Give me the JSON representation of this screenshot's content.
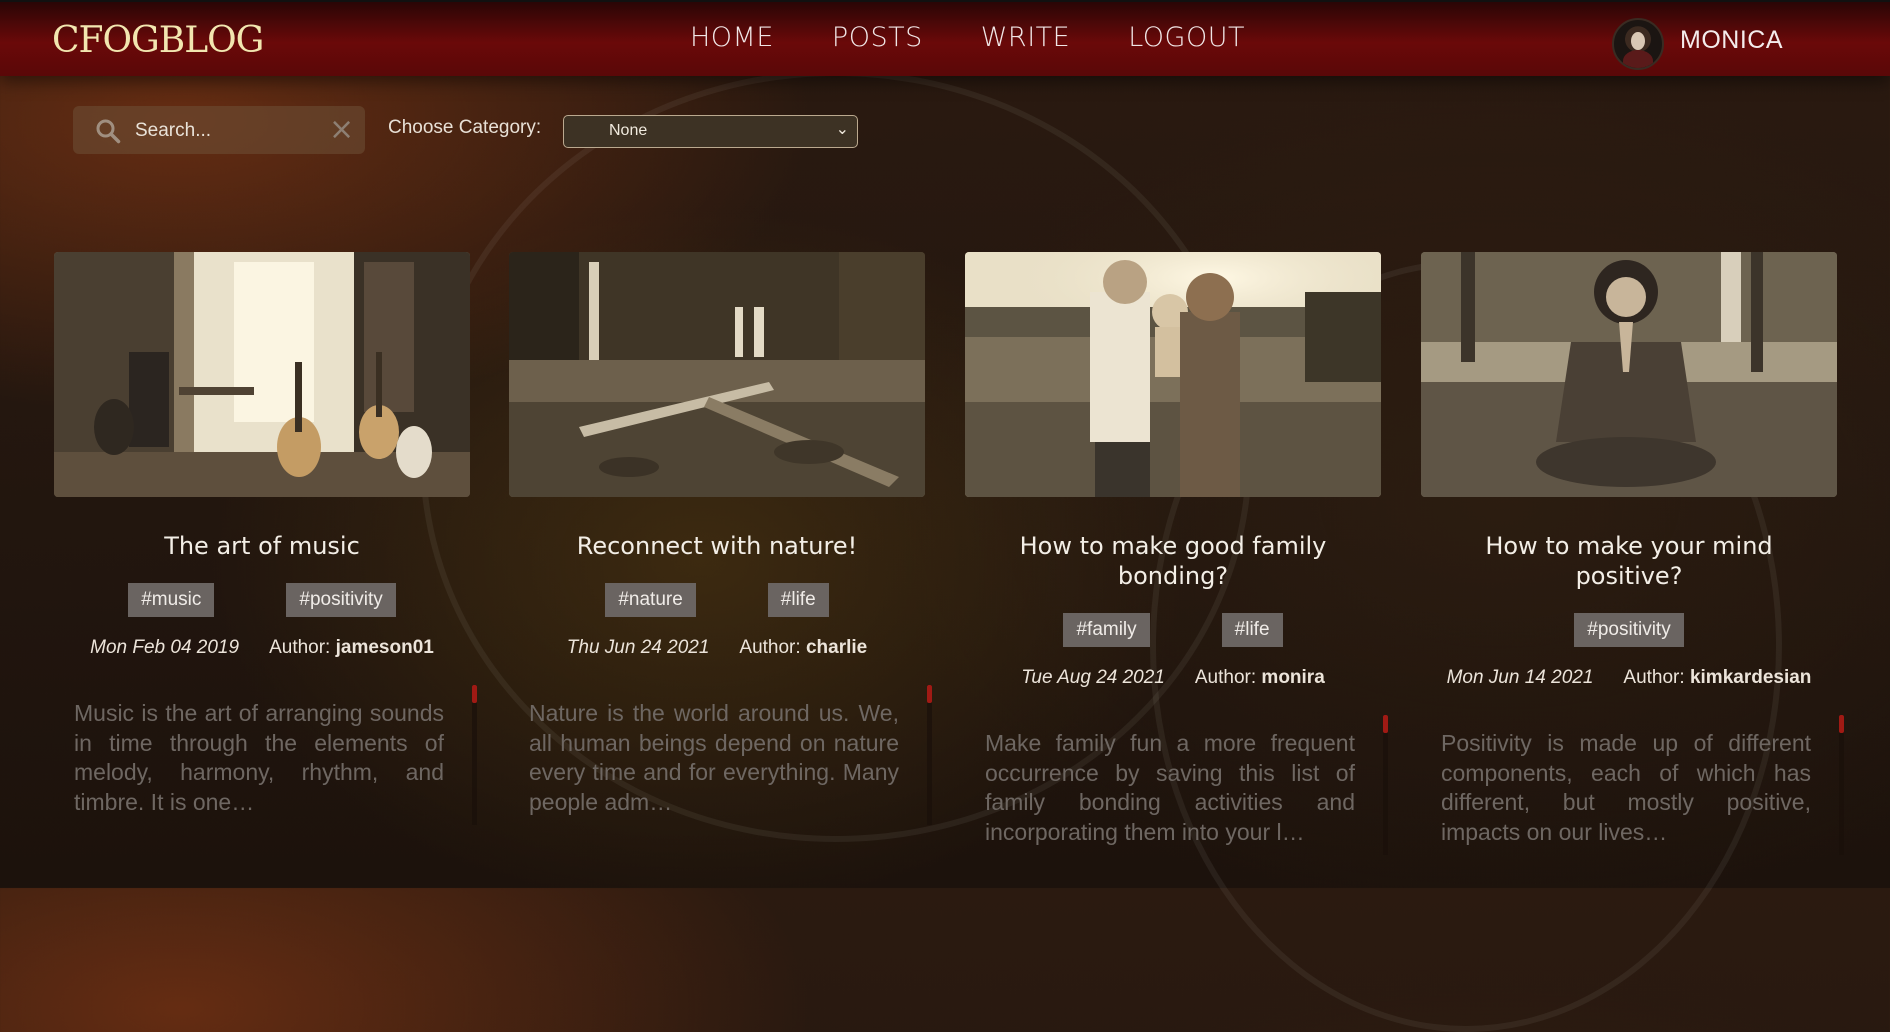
{
  "app": {
    "logo_text": "CFOGBLOG"
  },
  "nav": {
    "links": [
      "HOME",
      "POSTS",
      "WRITE",
      "LOGOUT"
    ],
    "username": "MONICA"
  },
  "filters": {
    "search_placeholder": "Search...",
    "category_label": "Choose Category:",
    "category_value": "None"
  },
  "posts": [
    {
      "title": "The art of music",
      "tags": [
        "#music",
        "#positivity"
      ],
      "date": "Mon Feb 04 2019",
      "author_label": "Author:",
      "author": "jameson01",
      "excerpt": "Music is the art of arranging sounds in time through the elements of melody, harmony, rhythm, and timbre. It is one…"
    },
    {
      "title": "Reconnect with nature!",
      "tags": [
        "#nature",
        "#life"
      ],
      "date": "Thu Jun 24 2021",
      "author_label": "Author:",
      "author": "charlie",
      "excerpt": "Nature is the world around us. We, all human beings depend on nature every time and for everything. Many people adm…"
    },
    {
      "title": "How to make good family bonding?",
      "tags": [
        "#family",
        "#life"
      ],
      "date": "Tue Aug 24 2021",
      "author_label": "Author:",
      "author": "monira",
      "excerpt": "Make family fun a more frequent occurrence by saving this list of family bonding activities and incorporating them into your l…"
    },
    {
      "title": "How to make your mind positive?",
      "tags": [
        "#positivity"
      ],
      "date": "Mon Jun 14 2021",
      "author_label": "Author:",
      "author": "kimkardesian",
      "excerpt": "Positivity is made up of different components, each of which has different, but mostly positive, impacts on our lives…"
    }
  ],
  "colors": {
    "header": "#6a0909",
    "tag_bg": "#6a6461",
    "scroll_thumb": "#a01a14"
  }
}
